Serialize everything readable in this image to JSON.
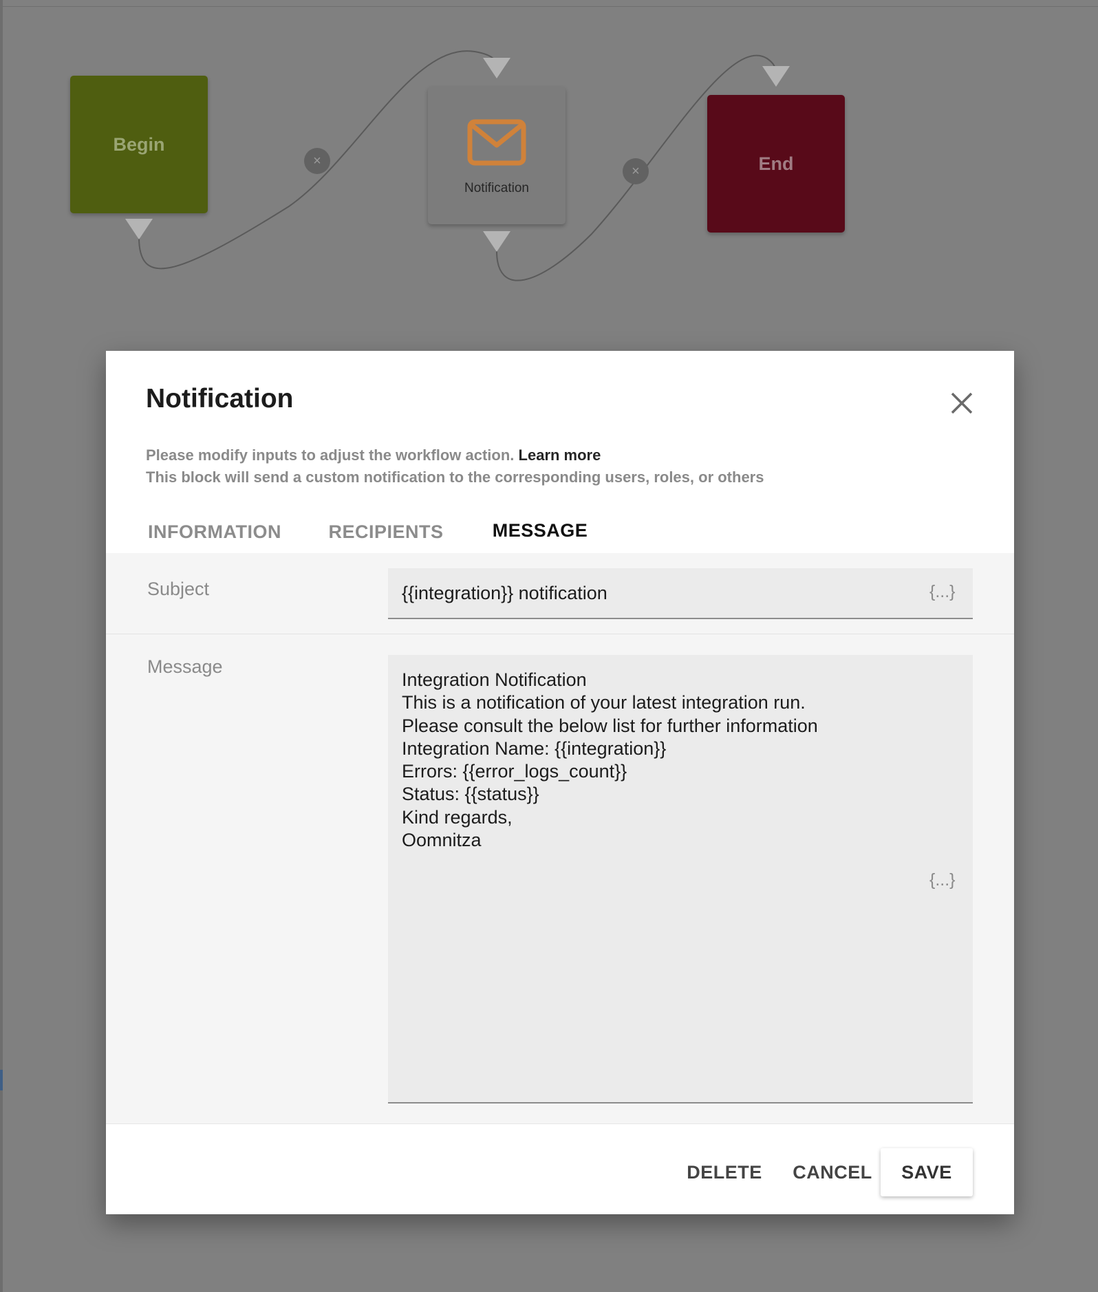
{
  "canvas": {
    "nodes": {
      "begin": {
        "label": "Begin",
        "color": "#4f5e10"
      },
      "notification": {
        "label": "Notification",
        "icon": "envelope-icon",
        "icon_color": "#d0823a"
      },
      "end": {
        "label": "End",
        "color": "#580a19"
      }
    },
    "remove_symbol": "×"
  },
  "modal": {
    "title": "Notification",
    "description_line1": "Please modify inputs to adjust the workflow action.",
    "learn_more": "Learn more",
    "description_line2": "This block will send a custom notification to the corresponding users, roles, or others",
    "tabs": [
      {
        "label": "INFORMATION",
        "active": false
      },
      {
        "label": "RECIPIENTS",
        "active": false
      },
      {
        "label": "MESSAGE",
        "active": true
      }
    ],
    "subject": {
      "label": "Subject",
      "value": "{{integration}} notification",
      "variable_button": "{...}"
    },
    "message": {
      "label": "Message",
      "lines": [
        "Integration Notification",
        "This is a notification of your latest integration run.",
        "Please consult the below list for further information",
        "Integration Name: {{integration}}",
        "Errors: {{error_logs_count}}",
        "Status: {{status}}",
        "Kind regards,",
        "Oomnitza"
      ],
      "variable_button": "{...}"
    },
    "buttons": {
      "delete": "DELETE",
      "cancel": "CANCEL",
      "save": "SAVE"
    }
  }
}
